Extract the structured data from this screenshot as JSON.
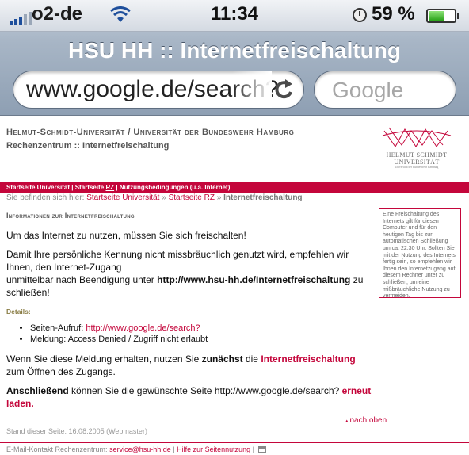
{
  "status_bar": {
    "carrier": "o2-de",
    "time": "11:34",
    "battery_percent": "59 %",
    "battery_level": 0.59,
    "icons": [
      "signal-bars-icon",
      "wifi-icon",
      "alarm-clock-icon",
      "battery-icon"
    ]
  },
  "browser": {
    "page_title": "HSU HH :: Internetfreischaltung",
    "url": "www.google.de/search?",
    "search_placeholder": "Google"
  },
  "header": {
    "university": "Helmut-Schmidt-Universität / Universität der Bundeswehr Hamburg",
    "subtitle": "Rechenzentrum :: Internetfreischaltung",
    "logo_line1": "HELMUT SCHMIDT",
    "logo_line2": "UNIVERSITÄT",
    "logo_line3": "Universität der Bundeswehr Hamburg"
  },
  "nav": {
    "item1": "Startseite Universität",
    "sep": "|",
    "item2_prefix": "Startseite ",
    "item2_abbr": "RZ",
    "item3": "Nutzungsbedingungen (u.a. Internet)"
  },
  "breadcrumb": {
    "prefix": "Sie befinden sich hier:",
    "link1": "Startseite Universität",
    "arrow": "»",
    "link2_prefix": "Startseite ",
    "link2_abbr": "RZ",
    "current": "Internetfreischaltung"
  },
  "section_title": "Informationen zur Internetfreischaltung",
  "content": {
    "p1": "Um das Internet zu nutzen, müssen Sie sich freischalten!",
    "p2a": "Damit Ihre persönliche Kennung nicht missbräuchlich genutzt wird, empfehlen wir Ihnen, den Internet-Zugang",
    "p2b": "unmittelbar nach Beendigung unter ",
    "p2_link": "http://www.hsu-hh.de/Internetfreischaltung",
    "p2c": " zu schließen!",
    "details_label": "Details:",
    "d1_label": "Seiten-Aufruf: ",
    "d1_link": "http://www.google.de/search?",
    "d2": "Meldung: Access Denied / Zugriff nicht erlaubt",
    "p3a": "Wenn Sie diese Meldung erhalten, nutzen Sie ",
    "p3_bold": "zunächst",
    "p3b": " die ",
    "p3_link": "Internetfreischaltung",
    "p3c": " zum Öffnen des Zugangs.",
    "p4_bold": "Anschließend",
    "p4a": " können Sie die gewünschte Seite http://www.google.de/search? ",
    "p4_link": "erneut laden."
  },
  "sidebox": "Eine Freischaltung des Internets gilt für diesen Computer und für den heutigen Tag bis zur automatischen Schließung um ca. 22:30 Uhr. Sollten Sie mit der Nutzung des Internets fertig sein, so empfehlen wir Ihnen den Internetzugang auf diesem Rechner unter zu schließen, um eine mißbräuchliche Nutzung zu vermeiden.",
  "to_top": "nach oben",
  "stand": "Stand dieser Seite: 16.08.2005 (Webmaster)",
  "footer": {
    "prefix": "E-Mail-Kontakt Rechenzentrum: ",
    "email": "service@hsu-hh.de",
    "sep": " | ",
    "help": "Hilfe zur Seitennutzung",
    "sep2": " | "
  },
  "colors": {
    "brand_red": "#c4063b",
    "chrome_blue": "#8e9fb3"
  }
}
